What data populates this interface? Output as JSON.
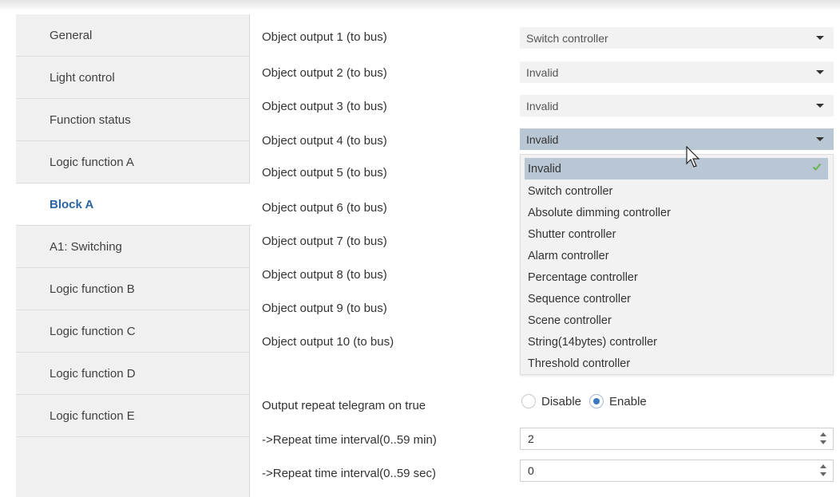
{
  "sidebar": {
    "items": [
      {
        "label": "General",
        "active": false
      },
      {
        "label": "Light control",
        "active": false
      },
      {
        "label": "Function status",
        "active": false
      },
      {
        "label": "Logic function A",
        "active": false
      },
      {
        "label": "Block A",
        "active": true
      },
      {
        "label": "A1: Switching",
        "active": false
      },
      {
        "label": "Logic function B",
        "active": false
      },
      {
        "label": "Logic function C",
        "active": false
      },
      {
        "label": "Logic function D",
        "active": false
      },
      {
        "label": "Logic function E",
        "active": false
      }
    ]
  },
  "params": {
    "outputs": [
      {
        "label": "Object output 1 (to bus)",
        "value": "Switch controller"
      },
      {
        "label": "Object output 2 (to bus)",
        "value": "Invalid"
      },
      {
        "label": "Object output 3 (to bus)",
        "value": "Invalid"
      },
      {
        "label": "Object output 4 (to bus)",
        "value": "Invalid"
      },
      {
        "label": "Object output 5 (to bus)"
      },
      {
        "label": "Object output 6 (to bus)"
      },
      {
        "label": "Object output 7 (to bus)"
      },
      {
        "label": "Object output 8 (to bus)"
      },
      {
        "label": "Object output 9 (to bus)"
      },
      {
        "label": "Object output 10 (to bus)"
      }
    ],
    "dropdown_options": [
      "Invalid",
      "Switch controller",
      "Absolute dimming controller",
      "Shutter controller",
      "Alarm controller",
      "Percentage controller",
      "Sequence controller",
      "Scene controller",
      "String(14bytes) controller",
      "Threshold controller"
    ],
    "dropdown_selected": "Invalid",
    "repeat_telegram": {
      "label": "Output repeat telegram on true",
      "options": [
        "Disable",
        "Enable"
      ],
      "selected": "Enable"
    },
    "repeat_min": {
      "label": "->Repeat time interval(0..59 min)",
      "value": "2"
    },
    "repeat_sec": {
      "label": "->Repeat time interval(0..59 sec)",
      "value": "0"
    }
  },
  "colors": {
    "active_nav": "#2b64a4",
    "selection": "#b9c7d5",
    "check": "#6ab04c",
    "radio_dot": "#3a78c0"
  },
  "icons": {
    "caret": "chevron-down-icon",
    "check": "checkmark-icon",
    "cursor": "mouse-pointer-icon",
    "spin": "spin-arrows-icon"
  }
}
